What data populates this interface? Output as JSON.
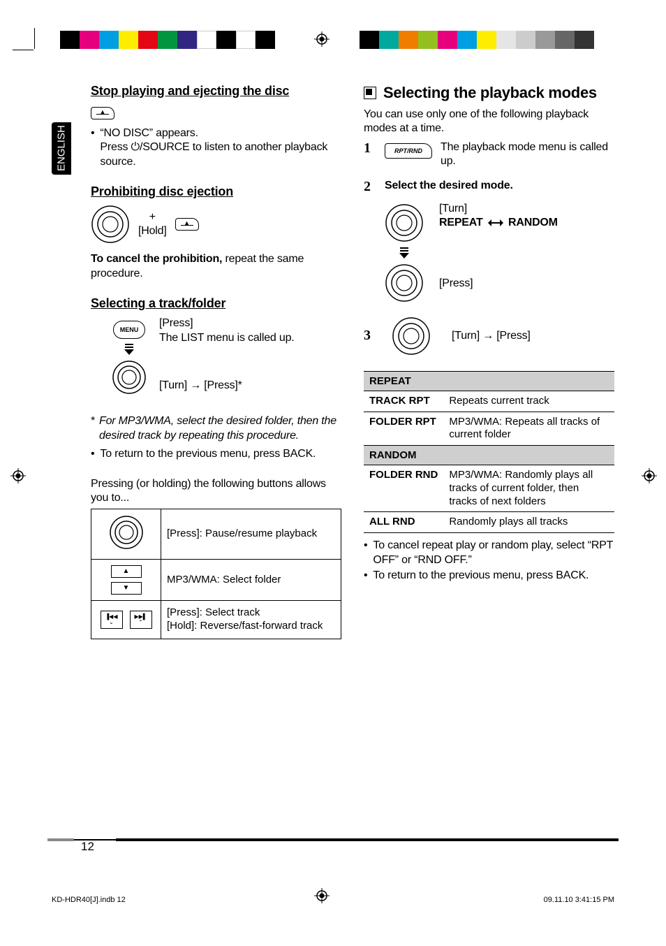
{
  "lang_tab": "ENGLISH",
  "left": {
    "h_stop": "Stop playing and ejecting the disc",
    "no_disc_bullet": "“NO DISC” appears.",
    "press_source": "Press ⏻/SOURCE to listen to another playback source.",
    "h_prohibit": "Prohibiting disc ejection",
    "hold_label": "[Hold]",
    "plus": "+",
    "cancel_bold": "To cancel the prohibition,",
    "cancel_rest": " repeat the same procedure.",
    "h_select_track": "Selecting a track/folder",
    "press_lbl": "[Press]",
    "list_menu": "The LIST menu is called up.",
    "turn_press": "[Turn] → [Press]*",
    "mp3_note": "For MP3/WMA, select the desired folder, then the desired track by repeating this procedure.",
    "asterisk": "*",
    "return_prev": "To return to the previous menu, press BACK.",
    "buttons_intro": "Pressing (or holding) the following buttons allows you to...",
    "btn_tbl": {
      "pause": "[Press]: Pause/resume playback",
      "folder": "MP3/WMA: Select folder",
      "track_press": "[Press]: Select track",
      "track_hold": "[Hold]: Reverse/fast-forward track"
    }
  },
  "right": {
    "h_modes": "Selecting the playback modes",
    "modes_intro": "You can use only one of the following playback modes at a time.",
    "step1_lbl": "1",
    "step1_btn": "RPT/RND",
    "step1_text": "The playback mode menu is called up.",
    "step2_lbl": "2",
    "step2_text": "Select the desired mode.",
    "turn_lbl": "[Turn]",
    "repeat_random": "REPEAT ↔ RANDOM",
    "repeat": "REPEAT",
    "random": "RANDOM",
    "press_lbl": "[Press]",
    "step3_lbl": "3",
    "turn_press": "[Turn] → [Press]",
    "tbl": {
      "repeat_hdr": "REPEAT",
      "track_rpt": "TRACK RPT",
      "track_rpt_desc": "Repeats current track",
      "folder_rpt": "FOLDER RPT",
      "folder_rpt_desc": "MP3/WMA: Repeats all tracks of current folder",
      "random_hdr": "RANDOM",
      "folder_rnd": "FOLDER RND",
      "folder_rnd_desc": "MP3/WMA: Randomly plays all tracks of current folder, then tracks of next folders",
      "all_rnd": "ALL RND",
      "all_rnd_desc": "Randomly plays all tracks"
    },
    "cancel_note": "To cancel repeat play or random play, select “RPT OFF” or “RND OFF.”",
    "return_prev": "To return to the previous menu, press BACK."
  },
  "page_num": "12",
  "footer_file": "KD-HDR40[J].indb   12",
  "footer_time": "09.11.10   3:41:15 PM"
}
